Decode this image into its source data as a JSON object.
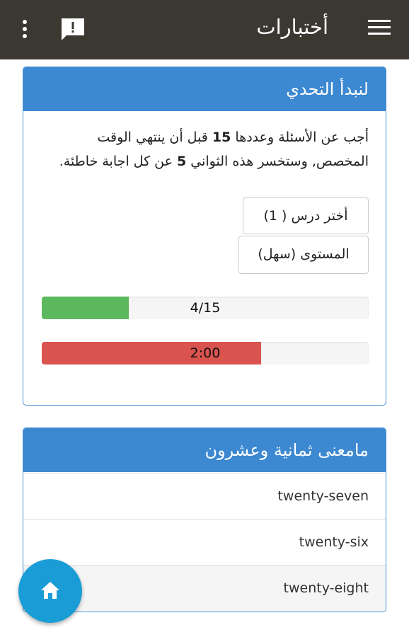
{
  "appbar": {
    "title": "أختبارات",
    "menu_icon": "hamburger-menu-icon",
    "feedback_icon": "feedback-icon",
    "overflow_icon": "more-vert-icon"
  },
  "intro_card": {
    "header": "لنبدأ التحدي",
    "desc_part1": "أجب عن الأسئلة وعددها ",
    "desc_questions": "15",
    "desc_part2": " قبل أن ينتهي الوقت المخصص, وستخسر هذه الثواني ",
    "desc_seconds": "5",
    "desc_part3": " عن كل اجابة خاطئة.",
    "lesson_button": "أختر درس ( 1)",
    "level_button": "المستوى (سهل)",
    "score_text": "4/15",
    "score_fraction": 0.2667,
    "time_text": "2:00",
    "time_fraction": 0.67
  },
  "question_card": {
    "header": "مامعنى ثمانية وعشرون",
    "options": [
      {
        "label": "twenty-seven"
      },
      {
        "label": "twenty-six"
      },
      {
        "label": "twenty-eight"
      }
    ]
  },
  "fab": {
    "icon": "home-icon"
  },
  "colors": {
    "appbar": "#3a3831",
    "card_header": "#3c88d1",
    "progress_success": "#5cb85c",
    "progress_danger": "#d9534f",
    "fab": "#1a9dd6"
  }
}
